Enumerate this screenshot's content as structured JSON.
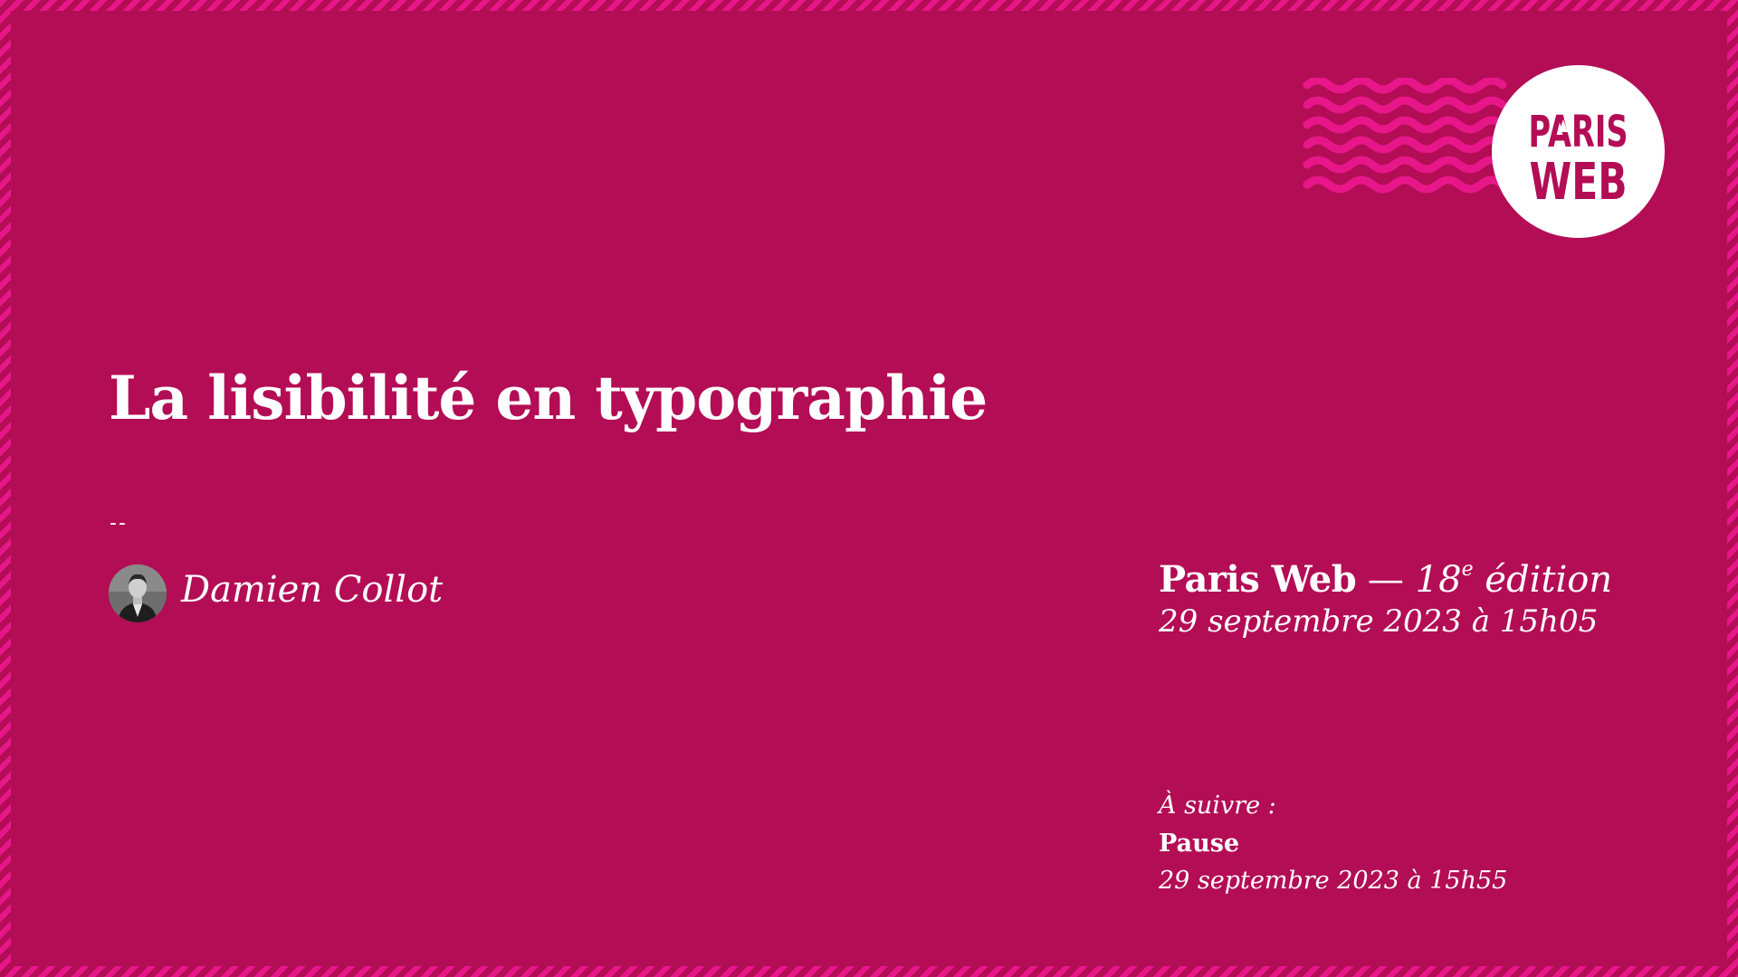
{
  "slide": {
    "title": "La lisibilité en typographie",
    "separator": "--",
    "speaker": "Damien Collot"
  },
  "event": {
    "name": "Paris Web",
    "dash": " — ",
    "edition_number": "18",
    "edition_suffix": "e",
    "edition_word": " édition",
    "date": "29 septembre 2023 à 15h05"
  },
  "next": {
    "label": "À suivre :",
    "title": "Pause",
    "date": "29 septembre 2023 à 15h55"
  },
  "logo": {
    "line1": "PARIS",
    "line2": "WEB"
  },
  "colors": {
    "background": "#b30d55",
    "accent": "#e7178a",
    "text": "#ffffff"
  },
  "icons": {
    "speaker_avatar": "speaker-avatar",
    "waves": "wave-decoration-icon",
    "logo": "paris-web-logo"
  }
}
